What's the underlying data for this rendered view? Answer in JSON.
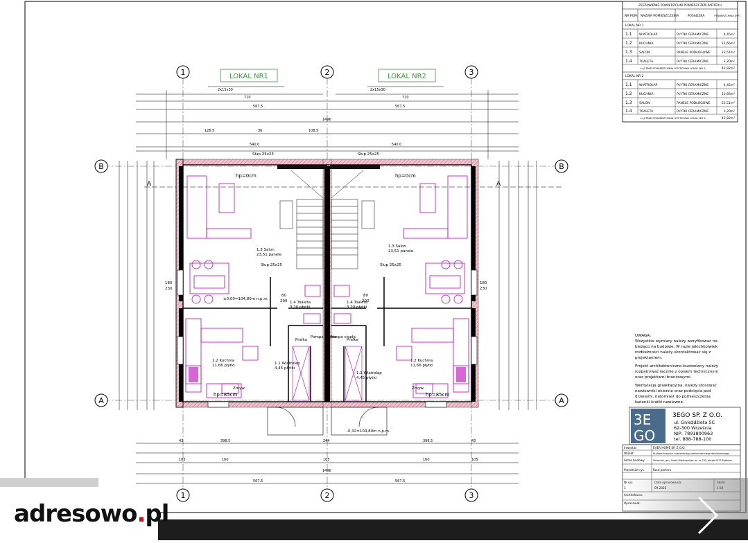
{
  "plan": {
    "unit_labels": [
      "LOKAL NR1",
      "LOKAL NR2"
    ],
    "axis_numbers": [
      "1",
      "2",
      "3"
    ],
    "axis_letters": [
      "A",
      "B"
    ],
    "section_mark": "A",
    "top_dims": {
      "total": "1496",
      "half": "710",
      "mid": "567.5",
      "beam": "2x15x30",
      "upper": [
        "126.5",
        "36",
        "108.5"
      ],
      "inner": [
        "540.0",
        "540.0"
      ]
    },
    "pillar": "Słup 25x25",
    "hp_top": "hp=0cm",
    "hp_bottom": "hp=85cm",
    "room_salon": "1.3 Salon",
    "room_salon_area": "23,51 panele",
    "room_toilet": "1.4 Toaleta",
    "room_toilet_area": "3,20 płytki",
    "room_kitchen": "1.2 Kuchnia",
    "room_kitchen_area": "11,66 płytki",
    "room_hall": "1.1 Wiatrołap",
    "room_hall_area": "4,45 płytki",
    "level": "±0,00=104,80m n.p.m.",
    "level2": "-0,32=104,80m n.p.m.",
    "window_dims": [
      "180",
      "230"
    ],
    "door_dims": [
      "80",
      "200"
    ],
    "pump": "Pompa ciepła",
    "laundry": "Pralka",
    "sink": "Zmyw.",
    "bottom_dims": {
      "row1": [
        "43",
        "398.5",
        "244",
        "398.5",
        "43"
      ],
      "row2": [
        "105",
        "160",
        "105",
        "160",
        "105"
      ],
      "total": "567.5",
      "overall": "1496"
    }
  },
  "table": {
    "title": "ZESTAWIENIE POWIERZCHNI POMIESZCZEŃ PARTERU",
    "headers": [
      "NR POM.",
      "NAZWA POMIESZCZENIA",
      "POSADZKA",
      "POWIERZCHNIA [m²]"
    ],
    "groups": [
      {
        "name": "LOKAL NR 1",
        "rows": [
          [
            "1.1",
            "WIATROŁAP",
            "PŁYTKI CERAMICZNE",
            "4,45m²"
          ],
          [
            "1.2",
            "KUCHNIA",
            "PŁYTKI CERAMICZNE",
            "11,66m²"
          ],
          [
            "1.3",
            "SALON",
            "PANELE PODŁOGOWE",
            "23,51m²"
          ],
          [
            "1.4",
            "TOALETA",
            "PŁYTKI CERAMICZNE",
            "3,20m²"
          ]
        ],
        "total_label": "ŁĄCZNIE POWIERZCHNIA UŻYTKOWA LOKAL NR 1:",
        "total": "42,82m²"
      },
      {
        "name": "LOKAL NR 2",
        "rows": [
          [
            "1.1",
            "WIATROŁAP",
            "PŁYTKI CERAMICZNE",
            "4,45m²"
          ],
          [
            "1.2",
            "KUCHNIA",
            "PŁYTKI CERAMICZNE",
            "11,66m²"
          ],
          [
            "1.3",
            "SALON",
            "PANELE PODŁOGOWE",
            "23,51m²"
          ],
          [
            "1.4",
            "TOALETA",
            "PŁYTKI CERAMICZNE",
            "3,20m²"
          ]
        ],
        "total_label": "ŁĄCZNIE POWIERZCHNIA UŻYTKOWA LOKAL NR 2:",
        "total": "42,82m²"
      }
    ]
  },
  "notes": {
    "heading": "UWAGA:",
    "p1": [
      "Wszystkie wymiary należy weryfikować na",
      "bieżąco na budowie. W razie jakichkolwiek",
      "rozbieżności należy skontaktować się z",
      "projektantem."
    ],
    "p2": [
      "Projekt architektoniczno-budowlany należy",
      "rozpatrywać łącznie z opisem technicznym",
      "oraz projektami branżowymi."
    ],
    "p3": [
      "Wentylacja grawitacyjna, należy stosować",
      "nawiewniki okienne oraz podcięcia pod",
      "drzwiami, natomiast do pomieszczenia",
      "łazienki kratki nawiewne."
    ]
  },
  "company": {
    "logo_top": "3E",
    "logo_bottom": "GO",
    "name": "3EGO SP. Z O.O.",
    "address1": "ul. Gnieźdźieta 5C",
    "address2": "62-300 Września",
    "nip": "NIP: 7891800963",
    "tel": "tel. 888-788-100"
  },
  "title_block": {
    "rows": [
      [
        "Inwestor:",
        "EVER HOME SP. Z O.O."
      ],
      [
        "Obiekt:",
        "Budowa budynku mieszkalnego jednorodzinnego dwulokalowego"
      ],
      [
        "Adres budowy:",
        "Skrzeczki, gm. Środa Wielkopolska dz. nr 782, obręb 0013 Pętkowo"
      ],
      [
        "Przedmiot rys.",
        "Rzut parteru"
      ]
    ],
    "cols": [
      "Nr rys.",
      "Data opracowania:",
      "Skala:"
    ],
    "vals": [
      "1",
      "09.2025",
      "1:50"
    ],
    "architect": "Architektura:",
    "projektant": "Opracował:"
  },
  "branding": {
    "site_main": "adresowo",
    "site_dot": ".",
    "site_tld": "pl",
    "next_icon": "chevron-right-icon"
  },
  "colors": {
    "wall": "#e6a6b4",
    "furniture": "#c000c0",
    "label_green": "#3a9a3a",
    "line": "#000000",
    "bar": "#1d1d1d",
    "accent_red": "#d0111b"
  }
}
